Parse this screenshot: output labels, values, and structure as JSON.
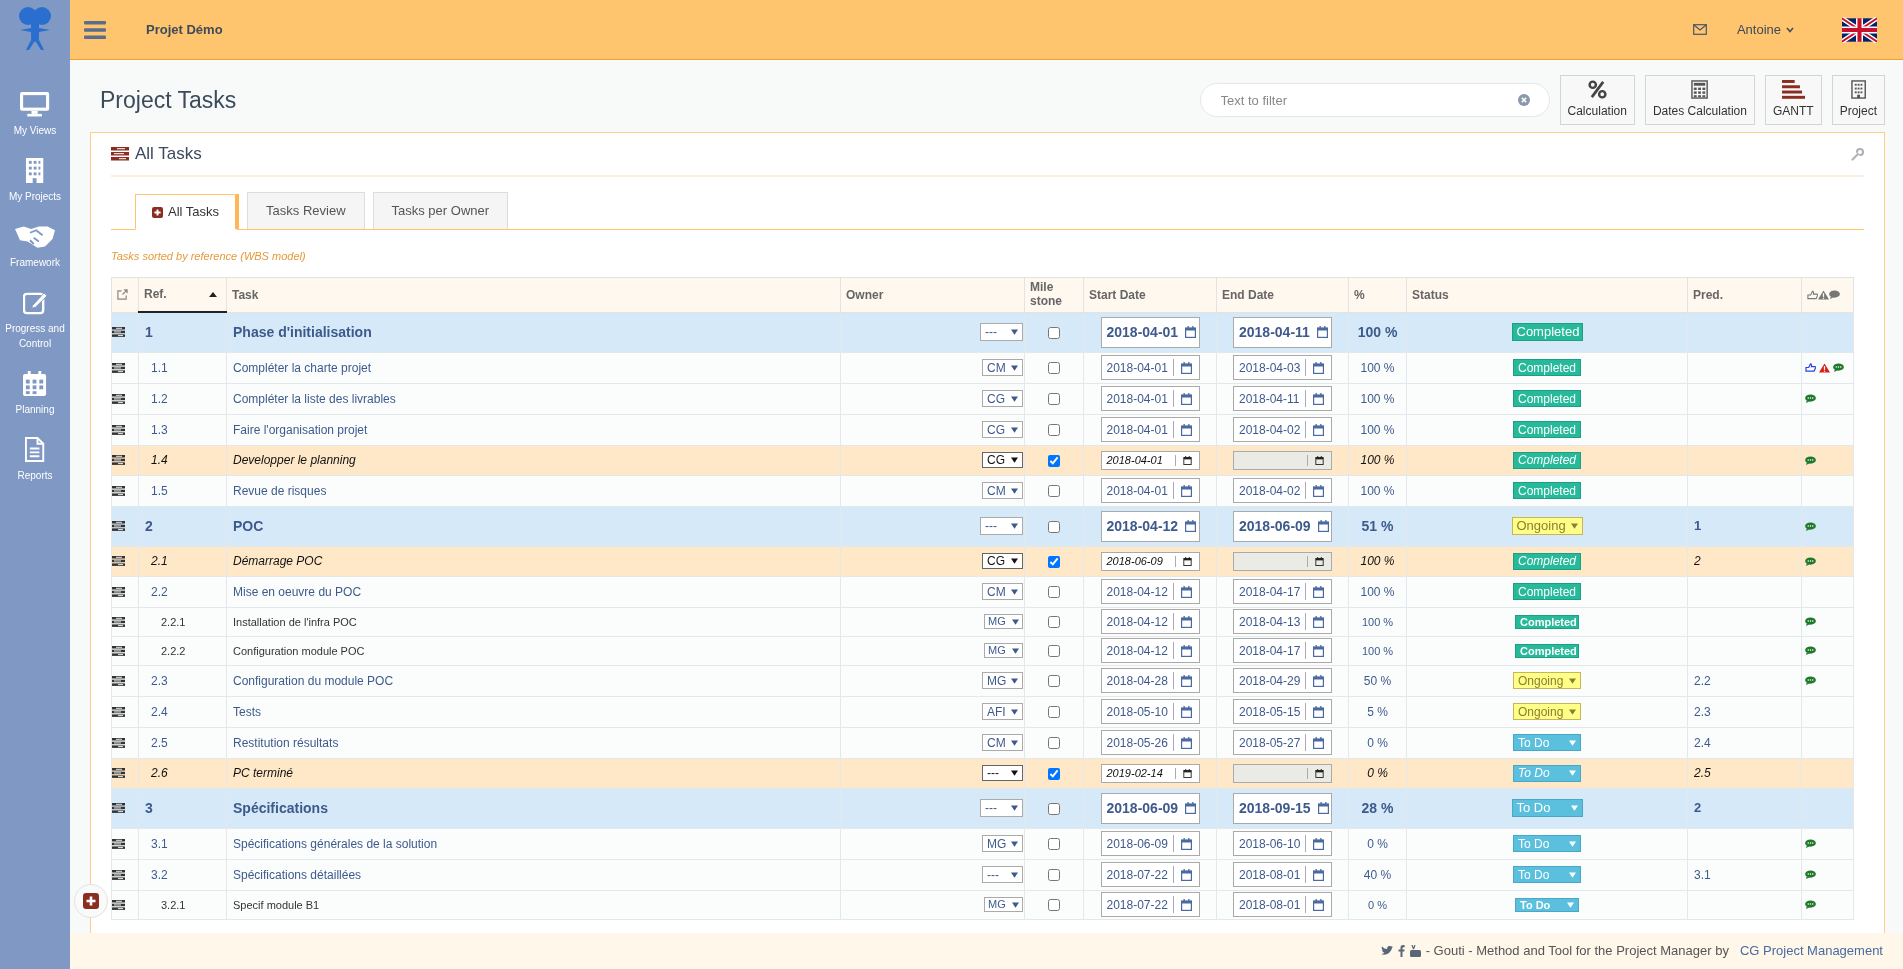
{
  "topbar": {
    "project": "Projet Démo",
    "user": "Antoine"
  },
  "sidebar": {
    "items": [
      {
        "label": "My Views"
      },
      {
        "label": "My Projects"
      },
      {
        "label": "Framework"
      },
      {
        "label": "Progress and Control"
      },
      {
        "label": "Planning"
      },
      {
        "label": "Reports"
      }
    ]
  },
  "page_title": "Project Tasks",
  "filter": {
    "placeholder": "Text to filter"
  },
  "toolbar": [
    {
      "label": "Calculation"
    },
    {
      "label": "Dates Calculation"
    },
    {
      "label": "GANTT"
    },
    {
      "label": "Project"
    }
  ],
  "panel": {
    "title": "All Tasks",
    "tabs": [
      {
        "label": "All Tasks",
        "selected": true
      },
      {
        "label": "Tasks Review",
        "selected": false
      },
      {
        "label": "Tasks per Owner",
        "selected": false
      }
    ],
    "note": "Tasks sorted by reference (WBS model)"
  },
  "table": {
    "columns": [
      "Ref.",
      "Task",
      "Owner",
      "Mile stone",
      "Start Date",
      "End Date",
      "%",
      "Status",
      "Pred."
    ],
    "rows": [
      {
        "kind": "phase",
        "ref": "1",
        "task": "Phase d'initialisation",
        "owner": "---",
        "milestone": false,
        "start": "2018-04-01",
        "end": "2018-04-11",
        "pct": "100 %",
        "status": {
          "label": "Completed",
          "kind": "completed"
        },
        "liked": false,
        "warning": false,
        "comment": false
      },
      {
        "kind": "task",
        "ref": "1.1",
        "task": "Compléter la charte projet",
        "owner": "CM",
        "milestone": false,
        "start": "2018-04-01",
        "end": "2018-04-03",
        "pct": "100 %",
        "status": {
          "label": "Completed",
          "kind": "completed"
        },
        "liked": true,
        "warning": true,
        "comment": true
      },
      {
        "kind": "task",
        "ref": "1.2",
        "task": "Compléter la liste des livrables",
        "owner": "CG",
        "milestone": false,
        "start": "2018-04-01",
        "end": "2018-04-11",
        "pct": "100 %",
        "status": {
          "label": "Completed",
          "kind": "completed"
        },
        "liked": false,
        "warning": false,
        "comment": true
      },
      {
        "kind": "task",
        "ref": "1.3",
        "task": "Faire l'organisation projet",
        "owner": "CG",
        "milestone": false,
        "start": "2018-04-01",
        "end": "2018-04-02",
        "pct": "100 %",
        "status": {
          "label": "Completed",
          "kind": "completed"
        },
        "liked": false,
        "warning": false,
        "comment": false
      },
      {
        "kind": "milestone",
        "ref": "1.4",
        "task": "Developper le planning",
        "owner": "CG",
        "milestone": true,
        "start": "2018-04-01",
        "pct": "100 %",
        "status": {
          "label": "Completed",
          "kind": "completed"
        },
        "liked": false,
        "warning": false,
        "comment": true
      },
      {
        "kind": "task",
        "ref": "1.5",
        "task": "Revue de risques",
        "owner": "CM",
        "milestone": false,
        "start": "2018-04-01",
        "end": "2018-04-02",
        "pct": "100 %",
        "status": {
          "label": "Completed",
          "kind": "completed"
        },
        "liked": false,
        "warning": false,
        "comment": false
      },
      {
        "kind": "phase",
        "ref": "2",
        "task": "POC",
        "owner": "---",
        "milestone": false,
        "start": "2018-04-12",
        "end": "2018-06-09",
        "pct": "51 %",
        "status": {
          "label": "Ongoing",
          "kind": "ongoing"
        },
        "pred": "1",
        "liked": false,
        "warning": false,
        "comment": true
      },
      {
        "kind": "milestone",
        "ref": "2.1",
        "task": "Démarrage POC",
        "owner": "CG",
        "milestone": true,
        "start": "2018-06-09",
        "pct": "100 %",
        "status": {
          "label": "Completed",
          "kind": "completed"
        },
        "pred": "2",
        "liked": false,
        "warning": false,
        "comment": true
      },
      {
        "kind": "task",
        "ref": "2.2",
        "task": "Mise en oeuvre du POC",
        "owner": "CM",
        "milestone": false,
        "start": "2018-04-12",
        "end": "2018-04-17",
        "pct": "100 %",
        "status": {
          "label": "Completed",
          "kind": "completed"
        },
        "liked": false,
        "warning": false,
        "comment": false
      },
      {
        "kind": "subtask",
        "ref": "2.2.1",
        "task": "Installation de l'infra POC",
        "owner": "MG",
        "milestone": false,
        "start": "2018-04-12",
        "end": "2018-04-13",
        "pct": "100 %",
        "status": {
          "label": "Completed",
          "kind": "completed"
        },
        "liked": false,
        "warning": false,
        "comment": true
      },
      {
        "kind": "subtask",
        "ref": "2.2.2",
        "task": "Configuration module POC",
        "owner": "MG",
        "milestone": false,
        "start": "2018-04-12",
        "end": "2018-04-17",
        "pct": "100 %",
        "status": {
          "label": "Completed",
          "kind": "completed"
        },
        "liked": false,
        "warning": false,
        "comment": true
      },
      {
        "kind": "task",
        "ref": "2.3",
        "task": "Configuration du module POC",
        "owner": "MG",
        "milestone": false,
        "start": "2018-04-28",
        "end": "2018-04-29",
        "pct": "50 %",
        "status": {
          "label": "Ongoing",
          "kind": "ongoing"
        },
        "pred": "2.2",
        "liked": false,
        "warning": false,
        "comment": true
      },
      {
        "kind": "task",
        "ref": "2.4",
        "task": "Tests",
        "owner": "AFI",
        "milestone": false,
        "start": "2018-05-10",
        "end": "2018-05-15",
        "pct": "5 %",
        "status": {
          "label": "Ongoing",
          "kind": "ongoing"
        },
        "pred": "2.3",
        "liked": false,
        "warning": false,
        "comment": false
      },
      {
        "kind": "task",
        "ref": "2.5",
        "task": "Restitution résultats",
        "owner": "CM",
        "milestone": false,
        "start": "2018-05-26",
        "end": "2018-05-27",
        "pct": "0 %",
        "status": {
          "label": "To Do",
          "kind": "todo"
        },
        "pred": "2.4",
        "liked": false,
        "warning": false,
        "comment": false
      },
      {
        "kind": "milestone",
        "ref": "2.6",
        "task": "PC terminé",
        "owner": "---",
        "milestone": true,
        "start": "2019-02-14",
        "pct": "0 %",
        "status": {
          "label": "To Do",
          "kind": "todo"
        },
        "pred": "2.5",
        "liked": false,
        "warning": false,
        "comment": false
      },
      {
        "kind": "phase",
        "ref": "3",
        "task": "Spécifications",
        "owner": "---",
        "milestone": false,
        "start": "2018-06-09",
        "end": "2018-09-15",
        "pct": "28 %",
        "status": {
          "label": "To Do",
          "kind": "todo"
        },
        "pred": "2",
        "liked": false,
        "warning": false,
        "comment": false
      },
      {
        "kind": "task",
        "ref": "3.1",
        "task": "Spécifications générales de la solution",
        "owner": "MG",
        "milestone": false,
        "start": "2018-06-09",
        "end": "2018-06-10",
        "pct": "0 %",
        "status": {
          "label": "To Do",
          "kind": "todo"
        },
        "liked": false,
        "warning": false,
        "comment": true
      },
      {
        "kind": "task",
        "ref": "3.2",
        "task": "Spécifications détaillées",
        "owner": "---",
        "milestone": false,
        "start": "2018-07-22",
        "end": "2018-08-01",
        "pct": "40 %",
        "status": {
          "label": "To Do",
          "kind": "todo"
        },
        "pred": "3.1",
        "liked": false,
        "warning": false,
        "comment": true
      },
      {
        "kind": "subtask",
        "ref": "3.2.1",
        "task": "Specif module B1",
        "owner": "MG",
        "milestone": false,
        "start": "2018-07-22",
        "end": "2018-08-01",
        "pct": "0 %",
        "status": {
          "label": "To Do",
          "kind": "todo"
        },
        "liked": false,
        "warning": false,
        "comment": true
      }
    ]
  },
  "footer": {
    "text": "- Gouti - Method and Tool for the Project Manager by",
    "link": "CG Project Management"
  }
}
